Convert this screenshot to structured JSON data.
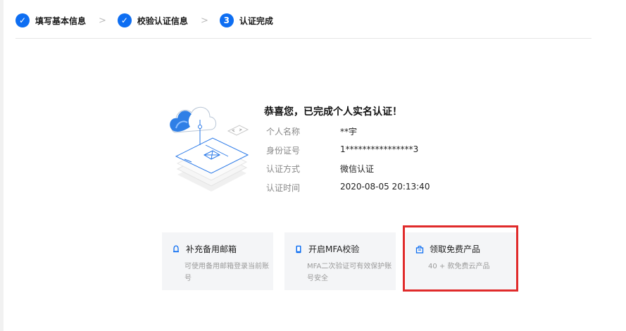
{
  "steps": [
    {
      "label": "填写基本信息",
      "marker": "✓",
      "state": "done"
    },
    {
      "label": "校验认证信息",
      "marker": "✓",
      "state": "done"
    },
    {
      "label": "认证完成",
      "marker": "3",
      "state": "current"
    }
  ],
  "step_separator": ">",
  "success": {
    "title": "恭喜您，已完成个人实名认证！",
    "rows": [
      {
        "label": "个人名称",
        "value": "**宇"
      },
      {
        "label": "身份证号",
        "value": "1****************3"
      },
      {
        "label": "认证方式",
        "value": "微信认证"
      },
      {
        "label": "认证时间",
        "value": "2020-08-05 20:13:40"
      }
    ]
  },
  "cards": [
    {
      "title": "补充备用邮箱",
      "desc": "可使用备用邮箱登录当前账号",
      "icon": "bell-icon"
    },
    {
      "title": "开启MFA校验",
      "desc": "MFA二次验证可有效保护账号安全",
      "icon": "phone-icon"
    },
    {
      "title": "领取免费产品",
      "desc": "40 + 款免费云产品",
      "icon": "bag-icon"
    }
  ],
  "colors": {
    "accent": "#0e6ef2",
    "highlight": "#e02b2b",
    "card_bg": "#f4f5f7"
  }
}
